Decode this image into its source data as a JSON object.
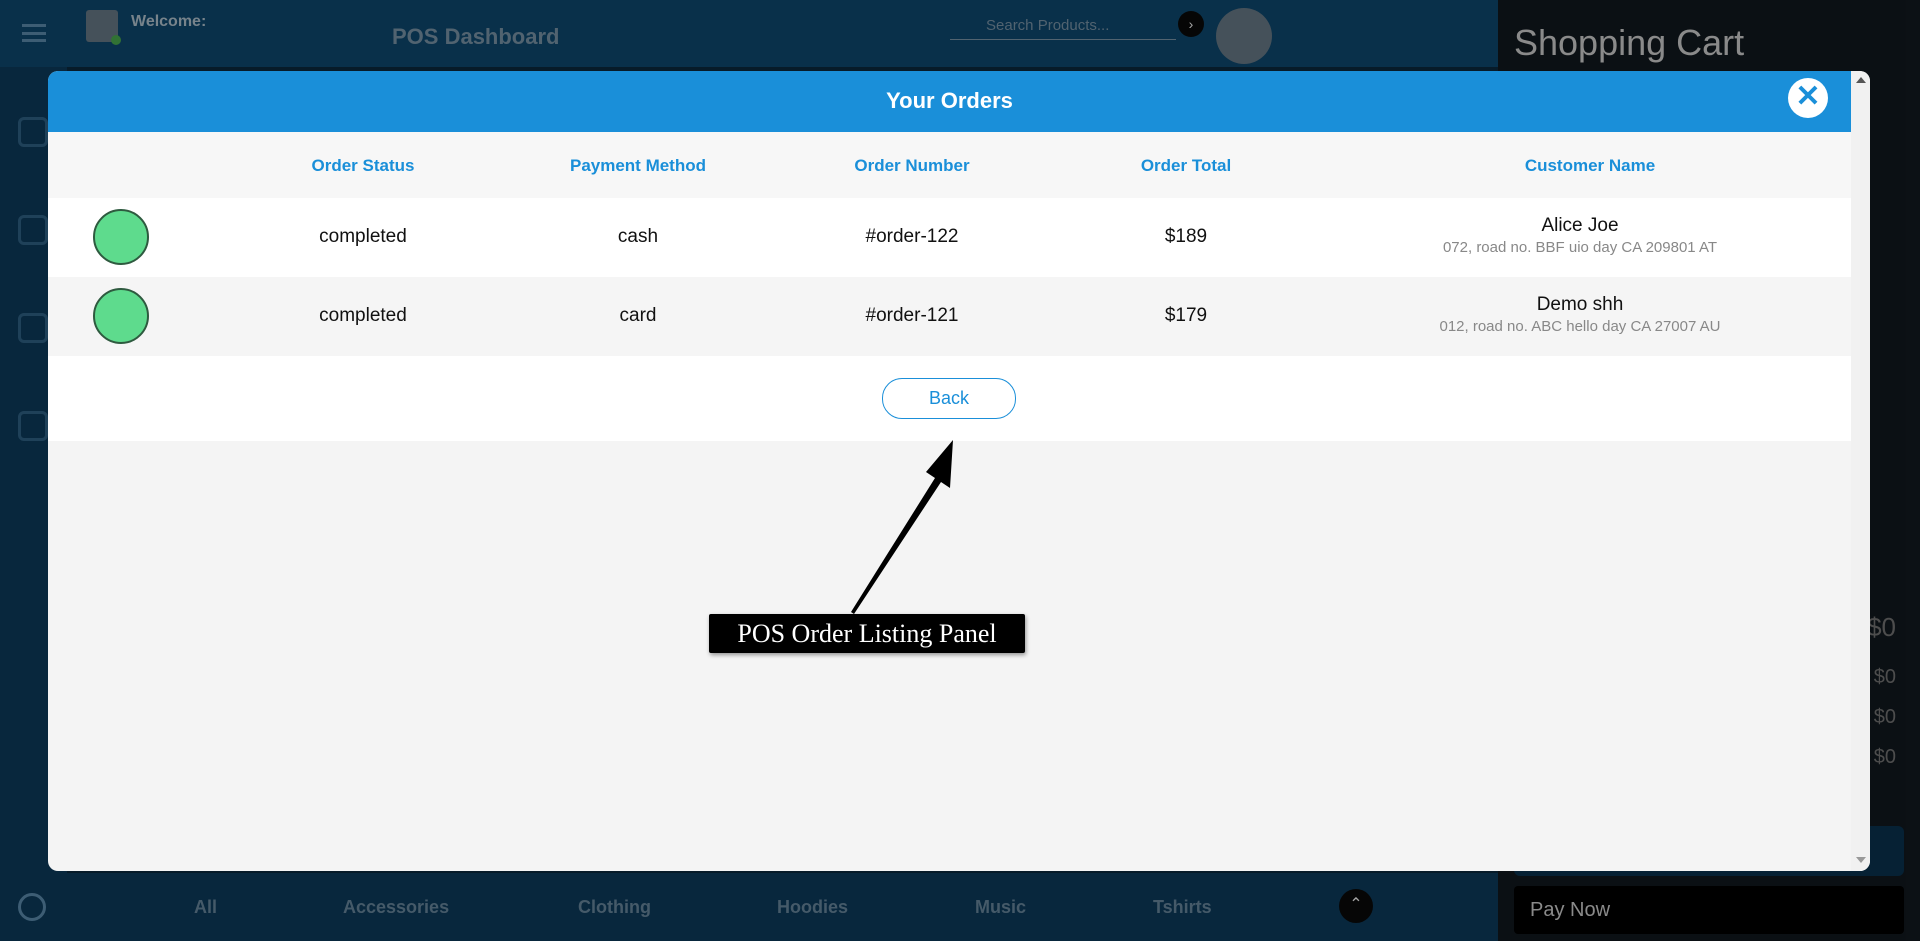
{
  "app": {
    "welcome_label": "Welcome:",
    "dashboard_title": "POS Dashboard",
    "search_placeholder": "Search Products...",
    "cart_title": "Shopping Cart",
    "cart_values": [
      "$0",
      "$0",
      "$0",
      "$0"
    ],
    "pay_now_label": "Pay Now",
    "categories": [
      "All",
      "Accessories",
      "Clothing",
      "Hoodies",
      "Music",
      "Tshirts"
    ]
  },
  "modal": {
    "title": "Your Orders",
    "close_icon": "close-icon",
    "columns": [
      "Order Status",
      "Payment Method",
      "Order Number",
      "Order Total",
      "Customer Name"
    ],
    "orders": [
      {
        "status": "completed",
        "status_color": "#5edb8d",
        "payment_method": "cash",
        "order_number": "#order-122",
        "order_total": "$189",
        "customer_name": "Alice Joe",
        "customer_address": "072, road no. BBF uio day CA 209801 AT"
      },
      {
        "status": "completed",
        "status_color": "#5edb8d",
        "payment_method": "card",
        "order_number": "#order-121",
        "order_total": "$179",
        "customer_name": "Demo shh",
        "customer_address": "012, road no. ABC hello day CA 27007 AU"
      }
    ],
    "back_label": "Back"
  },
  "annotation": {
    "label": "POS Order Listing Panel"
  },
  "colors": {
    "accent": "#1a8fd9",
    "status_completed": "#5edb8d"
  }
}
